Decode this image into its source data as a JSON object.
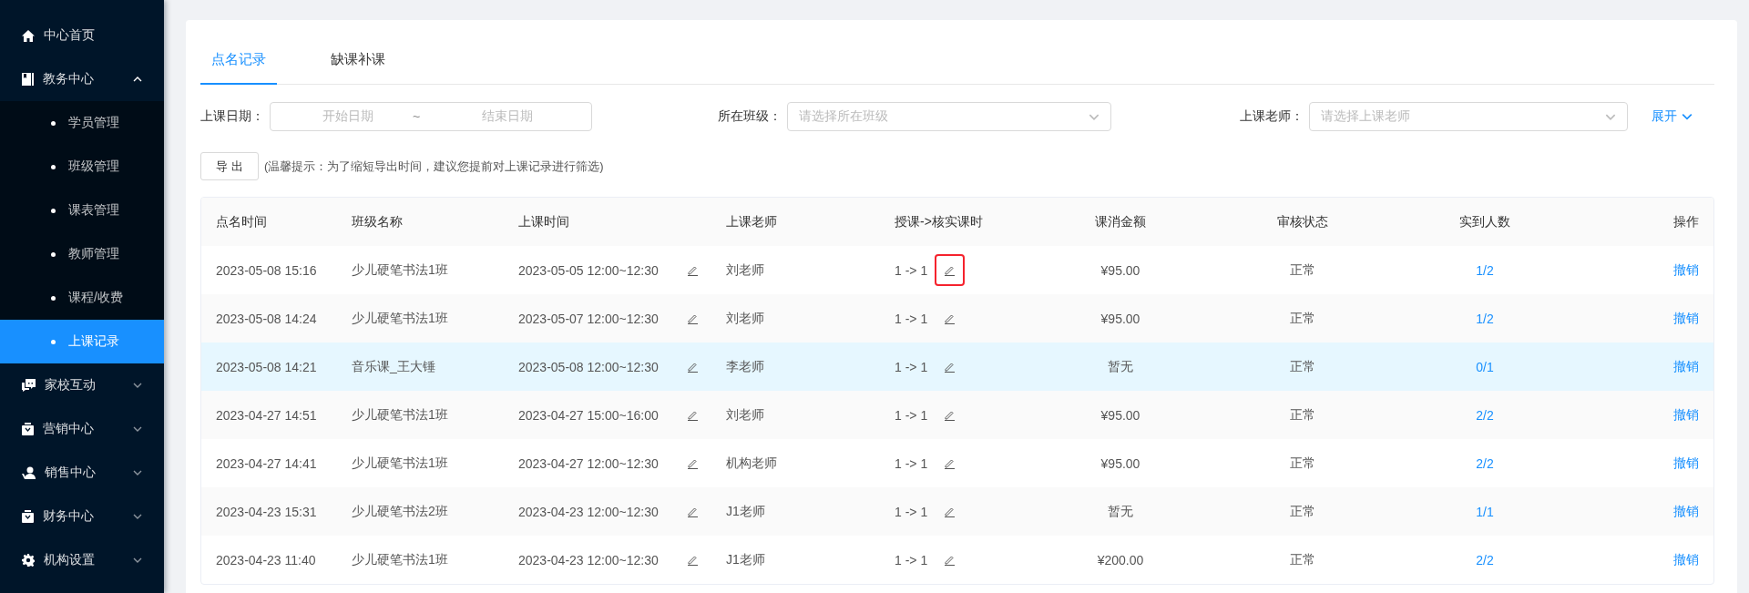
{
  "sidebar": {
    "items": [
      {
        "label": "中心首页"
      },
      {
        "label": "教务中心",
        "expanded": true,
        "children": [
          {
            "label": "学员管理",
            "selected": false
          },
          {
            "label": "班级管理",
            "selected": false
          },
          {
            "label": "课表管理",
            "selected": false
          },
          {
            "label": "教师管理",
            "selected": false
          },
          {
            "label": "课程/收费",
            "selected": false
          },
          {
            "label": "上课记录",
            "selected": true
          }
        ]
      },
      {
        "label": "家校互动",
        "expanded": false
      },
      {
        "label": "营销中心",
        "expanded": false
      },
      {
        "label": "销售中心",
        "expanded": false
      },
      {
        "label": "财务中心",
        "expanded": false
      },
      {
        "label": "机构设置",
        "expanded": false
      }
    ]
  },
  "tabs": [
    {
      "label": "点名记录",
      "selected": true
    },
    {
      "label": "缺课补课",
      "selected": false
    }
  ],
  "filters": {
    "date": {
      "label": "上课日期：",
      "start_placeholder": "开始日期",
      "separator": "~",
      "end_placeholder": "结束日期"
    },
    "class": {
      "label": "所在班级：",
      "placeholder": "请选择所在班级"
    },
    "teacher": {
      "label": "上课老师：",
      "placeholder": "请选择上课老师"
    },
    "expand_link": "展开"
  },
  "export": {
    "button": "导 出",
    "hint": "(温馨提示：为了缩短导出时间，建议您提前对上课记录进行筛选)"
  },
  "table": {
    "columns": [
      "点名时间",
      "班级名称",
      "上课时间",
      "上课老师",
      "授课->核实课时",
      "课消金额",
      "审核状态",
      "实到人数",
      "操作"
    ],
    "rows": [
      {
        "roll_call_time": "2023-05-08 15:16",
        "class_name": "少儿硬笔书法1班",
        "lesson_time": "2023-05-05 12:00~12:30",
        "teacher": "刘老师",
        "hours": "1 -> 1",
        "amount": "¥95.00",
        "status": "正常",
        "attendance": "1/2",
        "action": "撤销",
        "selected": false,
        "hours_edit_highlighted": true
      },
      {
        "roll_call_time": "2023-05-08 14:24",
        "class_name": "少儿硬笔书法1班",
        "lesson_time": "2023-05-07 12:00~12:30",
        "teacher": "刘老师",
        "hours": "1 -> 1",
        "amount": "¥95.00",
        "status": "正常",
        "attendance": "1/2",
        "action": "撤销",
        "selected": false,
        "hours_edit_highlighted": false
      },
      {
        "roll_call_time": "2023-05-08 14:21",
        "class_name": "音乐课_王大锤",
        "lesson_time": "2023-05-08 12:00~12:30",
        "teacher": "李老师",
        "hours": "1 -> 1",
        "amount": "暂无",
        "status": "正常",
        "attendance": "0/1",
        "action": "撤销",
        "selected": true,
        "hours_edit_highlighted": false
      },
      {
        "roll_call_time": "2023-04-27 14:51",
        "class_name": "少儿硬笔书法1班",
        "lesson_time": "2023-04-27 15:00~16:00",
        "teacher": "刘老师",
        "hours": "1 -> 1",
        "amount": "¥95.00",
        "status": "正常",
        "attendance": "2/2",
        "action": "撤销",
        "selected": false,
        "hours_edit_highlighted": false
      },
      {
        "roll_call_time": "2023-04-27 14:41",
        "class_name": "少儿硬笔书法1班",
        "lesson_time": "2023-04-27 12:00~12:30",
        "teacher": "机构老师",
        "hours": "1 -> 1",
        "amount": "¥95.00",
        "status": "正常",
        "attendance": "2/2",
        "action": "撤销",
        "selected": false,
        "hours_edit_highlighted": false
      },
      {
        "roll_call_time": "2023-04-23 15:31",
        "class_name": "少儿硬笔书法2班",
        "lesson_time": "2023-04-23 12:00~12:30",
        "teacher": "J1老师",
        "hours": "1 -> 1",
        "amount": "暂无",
        "status": "正常",
        "attendance": "1/1",
        "action": "撤销",
        "selected": false,
        "hours_edit_highlighted": false
      },
      {
        "roll_call_time": "2023-04-23 11:40",
        "class_name": "少儿硬笔书法1班",
        "lesson_time": "2023-04-23 12:00~12:30",
        "teacher": "J1老师",
        "hours": "1 -> 1",
        "amount": "¥200.00",
        "status": "正常",
        "attendance": "2/2",
        "action": "撤销",
        "selected": false,
        "hours_edit_highlighted": false
      }
    ]
  }
}
